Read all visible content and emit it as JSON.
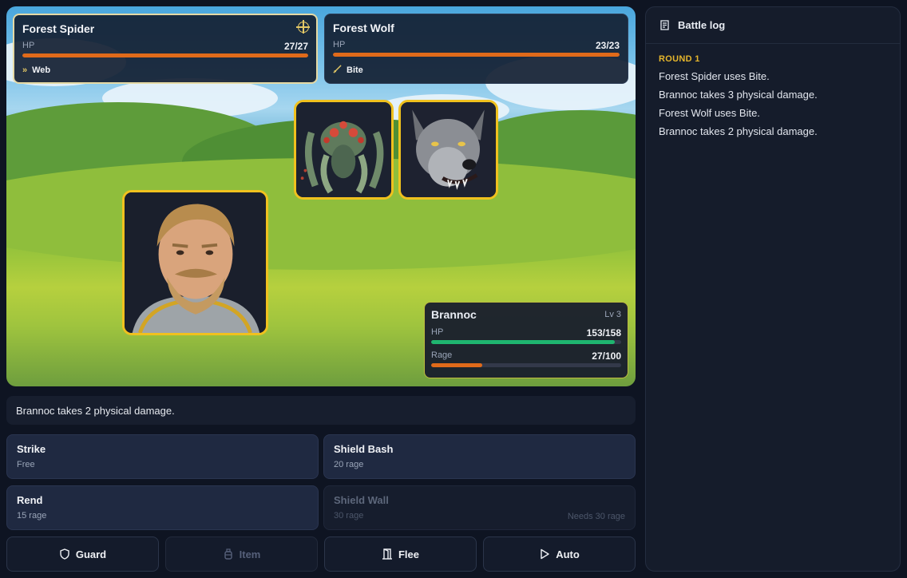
{
  "enemies": [
    {
      "name": "Forest Spider",
      "hp_label": "HP",
      "hp_value": "27/27",
      "hp_fraction": 1.0,
      "status": "Web",
      "status_icon": "web-chevron-icon",
      "targeted": true
    },
    {
      "name": "Forest Wolf",
      "hp_label": "HP",
      "hp_value": "23/23",
      "hp_fraction": 1.0,
      "status": "Bite",
      "status_icon": "sword-icon",
      "targeted": false
    }
  ],
  "player": {
    "name": "Brannoc",
    "level": "Lv 3",
    "hp_label": "HP",
    "hp_value": "153/158",
    "hp_fraction": 0.968,
    "rage_label": "Rage",
    "rage_value": "27/100",
    "rage_fraction": 0.27
  },
  "message": "Brannoc takes 2 physical damage.",
  "abilities": [
    {
      "name": "Strike",
      "cost": "Free",
      "enabled": true
    },
    {
      "name": "Shield Bash",
      "cost": "20 rage",
      "enabled": true
    },
    {
      "name": "Rend",
      "cost": "15 rage",
      "enabled": true
    },
    {
      "name": "Shield Wall",
      "cost": "30 rage",
      "requirement": "Needs 30 rage",
      "enabled": false
    }
  ],
  "actions": [
    {
      "label": "Guard",
      "icon": "shield-icon",
      "enabled": true
    },
    {
      "label": "Item",
      "icon": "potion-icon",
      "enabled": false
    },
    {
      "label": "Flee",
      "icon": "door-icon",
      "enabled": true
    },
    {
      "label": "Auto",
      "icon": "play-icon",
      "enabled": true
    }
  ],
  "log": {
    "title": "Battle log",
    "round_label": "ROUND 1",
    "entries": [
      "Forest Spider uses Bite.",
      "Brannoc takes 3 physical damage.",
      "Forest Wolf uses Bite.",
      "Brannoc takes 2 physical damage."
    ]
  },
  "colors": {
    "accent_gold": "#f0c11e",
    "hp_orange": "#e06a1a",
    "hp_green": "#1fb56f",
    "round_label": "#e6b62c"
  }
}
